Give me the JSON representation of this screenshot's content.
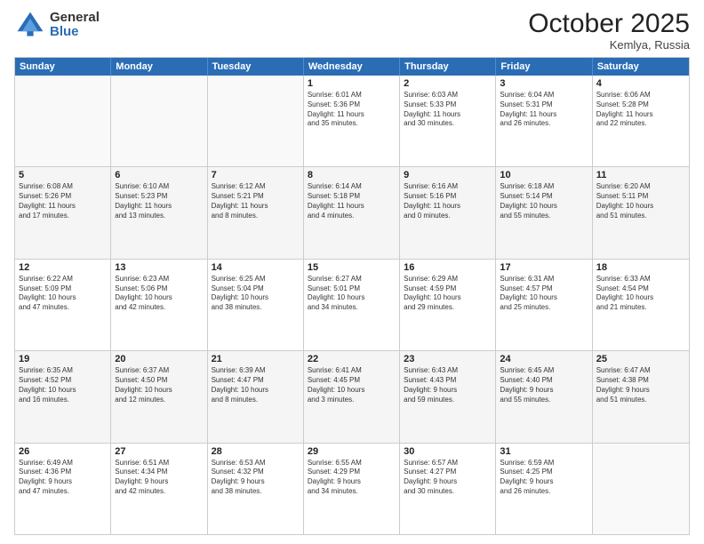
{
  "logo": {
    "general": "General",
    "blue": "Blue"
  },
  "header": {
    "month": "October 2025",
    "location": "Kemlya, Russia"
  },
  "days": [
    "Sunday",
    "Monday",
    "Tuesday",
    "Wednesday",
    "Thursday",
    "Friday",
    "Saturday"
  ],
  "rows": [
    [
      {
        "day": "",
        "lines": []
      },
      {
        "day": "",
        "lines": []
      },
      {
        "day": "",
        "lines": []
      },
      {
        "day": "1",
        "lines": [
          "Sunrise: 6:01 AM",
          "Sunset: 5:36 PM",
          "Daylight: 11 hours",
          "and 35 minutes."
        ]
      },
      {
        "day": "2",
        "lines": [
          "Sunrise: 6:03 AM",
          "Sunset: 5:33 PM",
          "Daylight: 11 hours",
          "and 30 minutes."
        ]
      },
      {
        "day": "3",
        "lines": [
          "Sunrise: 6:04 AM",
          "Sunset: 5:31 PM",
          "Daylight: 11 hours",
          "and 26 minutes."
        ]
      },
      {
        "day": "4",
        "lines": [
          "Sunrise: 6:06 AM",
          "Sunset: 5:28 PM",
          "Daylight: 11 hours",
          "and 22 minutes."
        ]
      }
    ],
    [
      {
        "day": "5",
        "lines": [
          "Sunrise: 6:08 AM",
          "Sunset: 5:26 PM",
          "Daylight: 11 hours",
          "and 17 minutes."
        ]
      },
      {
        "day": "6",
        "lines": [
          "Sunrise: 6:10 AM",
          "Sunset: 5:23 PM",
          "Daylight: 11 hours",
          "and 13 minutes."
        ]
      },
      {
        "day": "7",
        "lines": [
          "Sunrise: 6:12 AM",
          "Sunset: 5:21 PM",
          "Daylight: 11 hours",
          "and 8 minutes."
        ]
      },
      {
        "day": "8",
        "lines": [
          "Sunrise: 6:14 AM",
          "Sunset: 5:18 PM",
          "Daylight: 11 hours",
          "and 4 minutes."
        ]
      },
      {
        "day": "9",
        "lines": [
          "Sunrise: 6:16 AM",
          "Sunset: 5:16 PM",
          "Daylight: 11 hours",
          "and 0 minutes."
        ]
      },
      {
        "day": "10",
        "lines": [
          "Sunrise: 6:18 AM",
          "Sunset: 5:14 PM",
          "Daylight: 10 hours",
          "and 55 minutes."
        ]
      },
      {
        "day": "11",
        "lines": [
          "Sunrise: 6:20 AM",
          "Sunset: 5:11 PM",
          "Daylight: 10 hours",
          "and 51 minutes."
        ]
      }
    ],
    [
      {
        "day": "12",
        "lines": [
          "Sunrise: 6:22 AM",
          "Sunset: 5:09 PM",
          "Daylight: 10 hours",
          "and 47 minutes."
        ]
      },
      {
        "day": "13",
        "lines": [
          "Sunrise: 6:23 AM",
          "Sunset: 5:06 PM",
          "Daylight: 10 hours",
          "and 42 minutes."
        ]
      },
      {
        "day": "14",
        "lines": [
          "Sunrise: 6:25 AM",
          "Sunset: 5:04 PM",
          "Daylight: 10 hours",
          "and 38 minutes."
        ]
      },
      {
        "day": "15",
        "lines": [
          "Sunrise: 6:27 AM",
          "Sunset: 5:01 PM",
          "Daylight: 10 hours",
          "and 34 minutes."
        ]
      },
      {
        "day": "16",
        "lines": [
          "Sunrise: 6:29 AM",
          "Sunset: 4:59 PM",
          "Daylight: 10 hours",
          "and 29 minutes."
        ]
      },
      {
        "day": "17",
        "lines": [
          "Sunrise: 6:31 AM",
          "Sunset: 4:57 PM",
          "Daylight: 10 hours",
          "and 25 minutes."
        ]
      },
      {
        "day": "18",
        "lines": [
          "Sunrise: 6:33 AM",
          "Sunset: 4:54 PM",
          "Daylight: 10 hours",
          "and 21 minutes."
        ]
      }
    ],
    [
      {
        "day": "19",
        "lines": [
          "Sunrise: 6:35 AM",
          "Sunset: 4:52 PM",
          "Daylight: 10 hours",
          "and 16 minutes."
        ]
      },
      {
        "day": "20",
        "lines": [
          "Sunrise: 6:37 AM",
          "Sunset: 4:50 PM",
          "Daylight: 10 hours",
          "and 12 minutes."
        ]
      },
      {
        "day": "21",
        "lines": [
          "Sunrise: 6:39 AM",
          "Sunset: 4:47 PM",
          "Daylight: 10 hours",
          "and 8 minutes."
        ]
      },
      {
        "day": "22",
        "lines": [
          "Sunrise: 6:41 AM",
          "Sunset: 4:45 PM",
          "Daylight: 10 hours",
          "and 3 minutes."
        ]
      },
      {
        "day": "23",
        "lines": [
          "Sunrise: 6:43 AM",
          "Sunset: 4:43 PM",
          "Daylight: 9 hours",
          "and 59 minutes."
        ]
      },
      {
        "day": "24",
        "lines": [
          "Sunrise: 6:45 AM",
          "Sunset: 4:40 PM",
          "Daylight: 9 hours",
          "and 55 minutes."
        ]
      },
      {
        "day": "25",
        "lines": [
          "Sunrise: 6:47 AM",
          "Sunset: 4:38 PM",
          "Daylight: 9 hours",
          "and 51 minutes."
        ]
      }
    ],
    [
      {
        "day": "26",
        "lines": [
          "Sunrise: 6:49 AM",
          "Sunset: 4:36 PM",
          "Daylight: 9 hours",
          "and 47 minutes."
        ]
      },
      {
        "day": "27",
        "lines": [
          "Sunrise: 6:51 AM",
          "Sunset: 4:34 PM",
          "Daylight: 9 hours",
          "and 42 minutes."
        ]
      },
      {
        "day": "28",
        "lines": [
          "Sunrise: 6:53 AM",
          "Sunset: 4:32 PM",
          "Daylight: 9 hours",
          "and 38 minutes."
        ]
      },
      {
        "day": "29",
        "lines": [
          "Sunrise: 6:55 AM",
          "Sunset: 4:29 PM",
          "Daylight: 9 hours",
          "and 34 minutes."
        ]
      },
      {
        "day": "30",
        "lines": [
          "Sunrise: 6:57 AM",
          "Sunset: 4:27 PM",
          "Daylight: 9 hours",
          "and 30 minutes."
        ]
      },
      {
        "day": "31",
        "lines": [
          "Sunrise: 6:59 AM",
          "Sunset: 4:25 PM",
          "Daylight: 9 hours",
          "and 26 minutes."
        ]
      },
      {
        "day": "",
        "lines": []
      }
    ]
  ]
}
